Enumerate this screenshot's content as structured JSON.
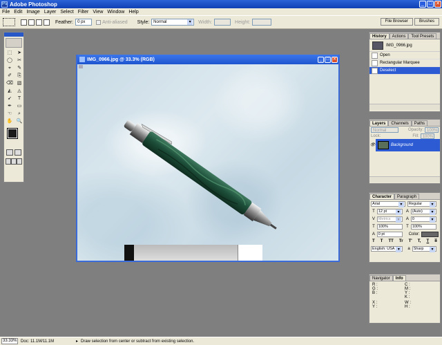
{
  "window": {
    "title": "Adobe Photoshop"
  },
  "menu": [
    "File",
    "Edit",
    "Image",
    "Layer",
    "Select",
    "Filter",
    "View",
    "Window",
    "Help"
  ],
  "options": {
    "feather_label": "Feather:",
    "feather_value": "0 px",
    "antialias_label": "Anti-aliased",
    "style_label": "Style:",
    "style_value": "Normal",
    "width_label": "Width:",
    "height_label": "Height:"
  },
  "palette_well": [
    "File Browser",
    "Brushes"
  ],
  "toolbox": {
    "tools": [
      "⬚",
      "➤",
      "◯",
      "✂",
      "⌖",
      "✎",
      "✐",
      "⎘",
      "⌫",
      "▧",
      "◭",
      "◬",
      "➹",
      "T",
      "✒",
      "▭",
      "☜",
      "⌕",
      "✋",
      "🔍"
    ]
  },
  "document": {
    "title": "IMG_0966.jpg @ 33.3% (RGB)"
  },
  "history": {
    "tabs": [
      "History",
      "Actions",
      "Tool Presets"
    ],
    "snapshot": "IMG_0966.jpg",
    "states": [
      "Open",
      "Rectangular Marquee",
      "Deselect"
    ]
  },
  "layers": {
    "tabs": [
      "Layers",
      "Channels",
      "Paths"
    ],
    "blend_mode": "Normal",
    "opacity_label": "Opacity:",
    "opacity_value": "100%",
    "lock_label": "Lock:",
    "fill_label": "Fill:",
    "fill_value": "100%",
    "layer_name": "Background"
  },
  "character": {
    "tabs": [
      "Character",
      "Paragraph"
    ],
    "font": "Arial",
    "style": "Regular",
    "size": "12 pt",
    "leading": "(Auto)",
    "kerning": "Metrics",
    "tracking": "0",
    "vscale": "100%",
    "hscale": "100%",
    "baseline": "0 pt",
    "color_label": "Color:",
    "format_buttons": [
      "T",
      "T",
      "TT",
      "Tr",
      "T'",
      "T,",
      "T",
      "T"
    ],
    "language": "English: USA",
    "antialias": "Sharp"
  },
  "info": {
    "tabs": [
      "Navigator",
      "Info"
    ],
    "rgb": [
      "R :",
      "G :",
      "B :"
    ],
    "cmyk": [
      "C :",
      "M :",
      "Y :",
      "K :"
    ],
    "xy": [
      "X :",
      "Y :"
    ],
    "wh": [
      "W :",
      "H :"
    ]
  },
  "status": {
    "zoom": "33.33%",
    "doc": "Doc: 11.1M/11.1M",
    "hint": "Draw selection from center or subtract from existing selection."
  }
}
